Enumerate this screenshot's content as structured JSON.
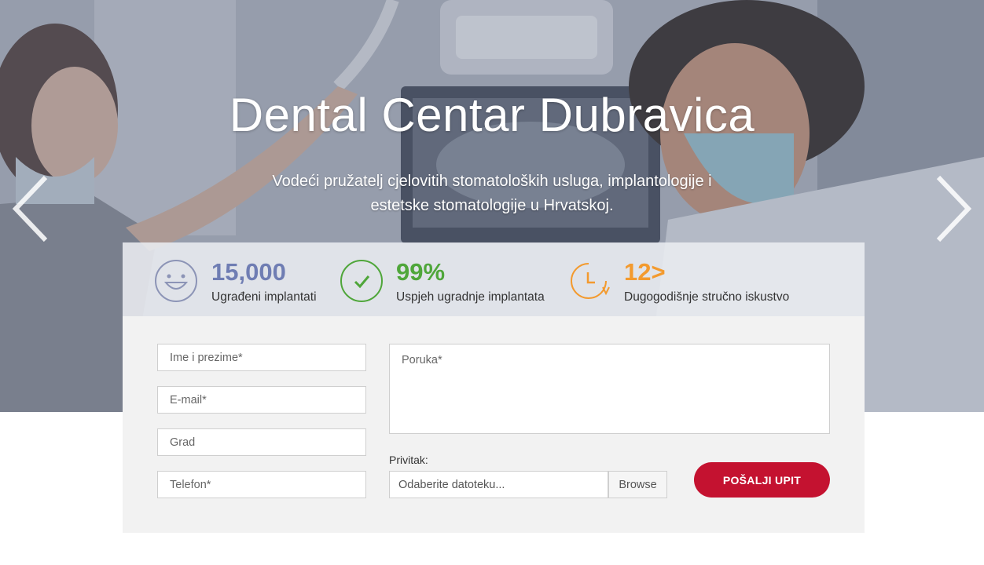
{
  "hero": {
    "title": "Dental Centar Dubravica",
    "subtitle": "Vodeći pružatelj cjelovitih stomatoloških usluga, implantologije i estetske stomatologije u Hrvatskoj.",
    "prev_icon": "chevron-left-icon",
    "next_icon": "chevron-right-icon"
  },
  "stats": [
    {
      "value": "15,000",
      "label": "Ugrađeni implantati",
      "icon": "smile-icon",
      "color": "#6f7db3"
    },
    {
      "value": "99%",
      "label": "Uspjeh ugradnje implantata",
      "icon": "check-circle-icon",
      "color": "#4fa63a"
    },
    {
      "value": "12>",
      "label": "Dugogodišnje stručno iskustvo",
      "icon": "clock-icon",
      "color": "#f39a2e"
    }
  ],
  "form": {
    "name_placeholder": "Ime i prezime*",
    "email_placeholder": "E-mail*",
    "city_placeholder": "Grad",
    "phone_placeholder": "Telefon*",
    "message_placeholder": "Poruka*",
    "attachment_label": "Privitak:",
    "file_placeholder": "Odaberite datoteku...",
    "browse_label": "Browse",
    "submit_label": "POŠALJI UPIT"
  },
  "colors": {
    "submit": "#c41230",
    "panel": "#f2f2f2"
  }
}
